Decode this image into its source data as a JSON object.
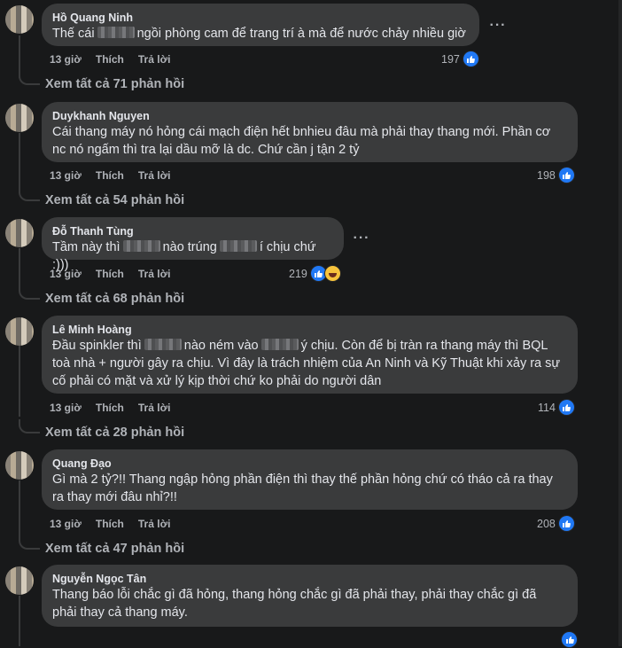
{
  "actions": {
    "time": "13 giờ",
    "like": "Thích",
    "reply": "Trả lời"
  },
  "comments": [
    {
      "author": "Hồ Quang Ninh",
      "text_a": "Thế cái",
      "text_b": "ngồi phòng cam để trang trí à mà để nước chảy nhiều giờ",
      "reactions": "197",
      "view_replies": "Xem tất cả 71 phản hồi"
    },
    {
      "author": "Duykhanh Nguyen",
      "text": "Cái thang máy nó hỏng cái mạch điện hết bnhieu đâu mà phải thay thang mới. Phần cơ\nnc nó ngấm thì tra lại dầu mỡ là dc. Chứ cần j tận 2 tỷ",
      "reactions": "198",
      "view_replies": "Xem tất cả 54 phản hồi"
    },
    {
      "author": "Đỗ Thanh Tùng",
      "text_a": "Tầm này thì",
      "text_b": "nào trúng",
      "text_c": "í chịu chứ :)))",
      "reactions": "219",
      "view_replies": "Xem tất cả 68 phản hồi"
    },
    {
      "author": "Lê Minh Hoàng",
      "text_a": "Đầu spinkler thì",
      "text_b": "nào ném vào",
      "text_c": "ý chịu. Còn để bị tràn ra thang máy thì BQL",
      "text_d": "toà nhà + người gây ra chịu. Vì đây là trách nhiệm của An Ninh và Kỹ Thuật khi xảy ra sự\ncố phải có mặt và xử lý kịp thời chứ ko phải do người dân",
      "reactions": "114",
      "view_replies": "Xem tất cả 28 phản hồi"
    },
    {
      "author": "Quang Đạo",
      "text": "Gì mà 2 tỷ?!! Thang ngập hỏng phần điện thì thay thế phần hỏng chứ có tháo cả ra thay\nra thay mới đâu nhỉ?!!",
      "reactions": "208",
      "view_replies": "Xem tất cả 47 phản hồi"
    },
    {
      "author": "Nguyễn Ngọc Tân",
      "text": "Thang báo lỗi chắc gì đã hỏng, thang hỏng chắc gì đã phải thay, phải thay chắc gì đã\nphải thay cả thang máy."
    }
  ]
}
